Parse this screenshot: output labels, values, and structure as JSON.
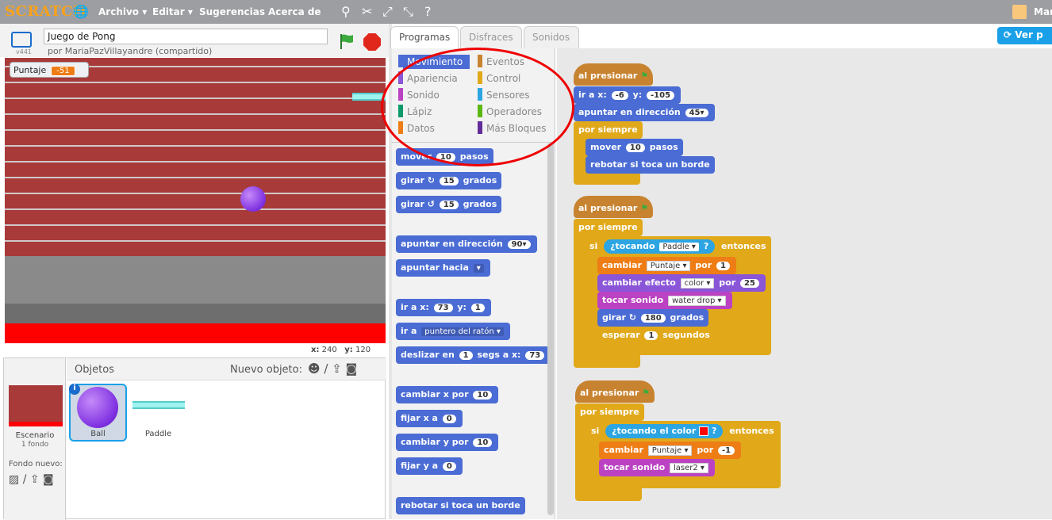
{
  "topbar": {
    "logo": "SCRATCH",
    "menus": [
      "Archivo ▾",
      "Editar ▾",
      "Sugerencias",
      "Acerca de"
    ],
    "user": "Mar"
  },
  "project": {
    "title": "Juego de Pong",
    "byline": "por MariaPazVillayandre (compartido)",
    "version": "v441"
  },
  "stage": {
    "monitor_label": "Puntaje",
    "monitor_value": "-51",
    "coords_x_label": "x:",
    "coords_x": "240",
    "coords_y_label": "y:",
    "coords_y": "120"
  },
  "sprites": {
    "header": "Objetos",
    "new_label": "Nuevo objeto:",
    "stage_name": "Escenario",
    "stage_sub": "1 fondo",
    "backdrop_label": "Fondo nuevo:",
    "items": [
      "Ball",
      "Paddle"
    ]
  },
  "tabs": [
    "Programas",
    "Disfraces",
    "Sonidos"
  ],
  "see_project": "Ver p",
  "categories": [
    {
      "label": "Movimiento",
      "color": "#4a6cd4"
    },
    {
      "label": "Eventos",
      "color": "#c88330"
    },
    {
      "label": "Apariencia",
      "color": "#8a55d7"
    },
    {
      "label": "Control",
      "color": "#e1a91a"
    },
    {
      "label": "Sonido",
      "color": "#bb42c3"
    },
    {
      "label": "Sensores",
      "color": "#2ca5e2"
    },
    {
      "label": "Lápiz",
      "color": "#0e9a6c"
    },
    {
      "label": "Operadores",
      "color": "#5cb712"
    },
    {
      "label": "Datos",
      "color": "#ee7d16"
    },
    {
      "label": "Más Bloques",
      "color": "#632d99"
    }
  ],
  "palette": {
    "move": "mover",
    "move_val": "10",
    "move_tail": "pasos",
    "turn_r": "girar ↻",
    "turn_r_val": "15",
    "turn_r_tail": "grados",
    "turn_l": "girar ↺",
    "turn_l_val": "15",
    "turn_l_tail": "grados",
    "point_dir": "apuntar en dirección",
    "point_dir_val": "90▾",
    "point_to": "apuntar hacia",
    "goto_xy": "ir a x:",
    "goto_x": "73",
    "goto_y_lbl": "y:",
    "goto_y": "1",
    "goto": "ir a",
    "goto_dd": "puntero del ratón ▾",
    "glide": "deslizar en",
    "glide_secs": "1",
    "glide_mid": "segs a x:",
    "glide_x": "73",
    "glide_y": "y:",
    "chx": "cambiar x por",
    "chx_val": "10",
    "setx": "fijar x a",
    "setx_val": "0",
    "chy": "cambiar y por",
    "chy_val": "10",
    "sety": "fijar y a",
    "sety_val": "0",
    "bounce": "rebotar si toca un borde"
  },
  "script1": {
    "hat": "al presionar",
    "goto": "ir a x:",
    "x": "-6",
    "ylbl": "y:",
    "y": "-105",
    "point": "apuntar en dirección",
    "dir": "45▾",
    "forever": "por siempre",
    "move": "mover",
    "mv": "10",
    "mtail": "pasos",
    "bounce": "rebotar si toca un borde"
  },
  "script2": {
    "hat": "al presionar",
    "forever": "por siempre",
    "if": "si",
    "touching": "¿tocando",
    "sprite": "Paddle ▾",
    "q": "?",
    "then": "entonces",
    "change": "cambiar",
    "var": "Puntaje ▾",
    "by": "por",
    "val": "1",
    "effect": "cambiar efecto",
    "eff": "color ▾",
    "eby": "por",
    "ev": "25",
    "play": "tocar sonido",
    "snd": "water drop ▾",
    "turn": "girar ↻",
    "deg": "180",
    "grados": "grados",
    "wait": "esperar",
    "secs": "1",
    "segundos": "segundos"
  },
  "script3": {
    "hat": "al presionar",
    "forever": "por siempre",
    "if": "si",
    "touching": "¿tocando el color",
    "q": "?",
    "then": "entonces",
    "change": "cambiar",
    "var": "Puntaje ▾",
    "by": "por",
    "val": "-1",
    "play": "tocar sonido",
    "snd": "laser2 ▾"
  }
}
